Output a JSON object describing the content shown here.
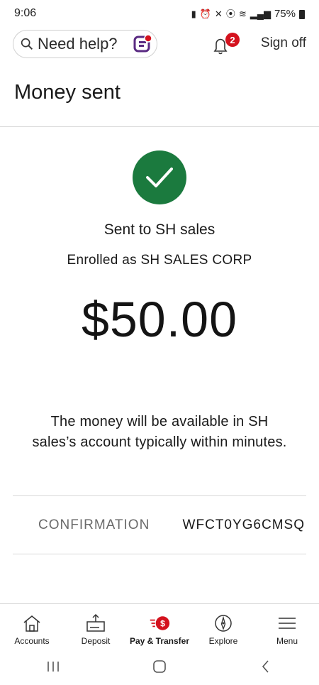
{
  "status_bar": {
    "time": "9:06",
    "battery": "75%"
  },
  "header": {
    "help_label": "Need help?",
    "notification_count": "2",
    "sign_off_label": "Sign off"
  },
  "page": {
    "title": "Money sent"
  },
  "confirmation": {
    "sent_to": "Sent to SH sales",
    "enrolled_as": "Enrolled as SH SALES CORP",
    "amount": "$50.00",
    "availability_message": "The money will be available in SH sales’s account typically within minutes.",
    "confirmation_label": "CONFIRMATION",
    "confirmation_number": "WFCT0YG6CMSQ"
  },
  "bottom_nav": {
    "items": [
      {
        "label": "Accounts",
        "icon": "home-icon"
      },
      {
        "label": "Deposit",
        "icon": "deposit-icon"
      },
      {
        "label": "Pay & Transfer",
        "icon": "pay-transfer-icon",
        "active": true
      },
      {
        "label": "Explore",
        "icon": "compass-icon"
      },
      {
        "label": "Menu",
        "icon": "hamburger-icon"
      }
    ]
  },
  "colors": {
    "brand_red": "#d4121e",
    "success_green": "#1b7a3e",
    "fargo_purple": "#5a2a82"
  }
}
